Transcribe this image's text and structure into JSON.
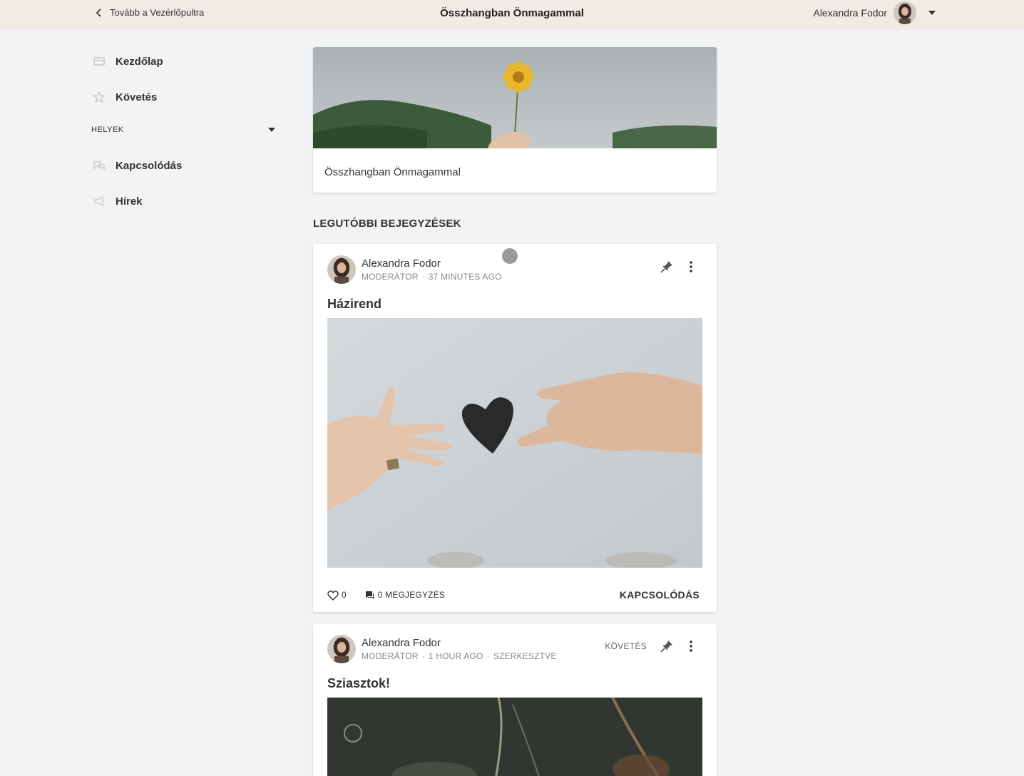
{
  "topbar": {
    "back_label": "Tovább a Vezérlőpultra",
    "title": "Összhangban Önmagammal",
    "user_name": "Alexandra Fodor"
  },
  "sidebar": {
    "items": [
      {
        "label": "Kezdőlap",
        "icon": "home-icon"
      },
      {
        "label": "Követés",
        "icon": "star-icon"
      }
    ],
    "section_label": "HELYEK",
    "places": [
      {
        "label": "Kapcsolódás",
        "icon": "chat-bubbles-icon"
      },
      {
        "label": "Hírek",
        "icon": "megaphone-icon"
      }
    ]
  },
  "space": {
    "name": "Összhangban Önmagammal"
  },
  "recent_posts_title": "LEGUTÓBBI BEJEGYZÉSEK",
  "posts": [
    {
      "author": "Alexandra Fodor",
      "role": "MODERÁTOR",
      "time": "37 MINUTES AGO",
      "title": "Házirend",
      "likes": "0",
      "comments": "0 MEGJEGYZÉS",
      "space": "KAPCSOLÓDÁS"
    },
    {
      "author": "Alexandra Fodor",
      "role": "MODERÁTOR",
      "time": "1 HOUR AGO",
      "edited": "SZERKESZTVE",
      "follow_label": "KÖVETÉS",
      "title": "Sziasztok!"
    }
  ],
  "colors": {
    "topbar_bg": "#f0ece4",
    "page_bg": "#f2f3f5",
    "card_bg": "#ffffff"
  }
}
